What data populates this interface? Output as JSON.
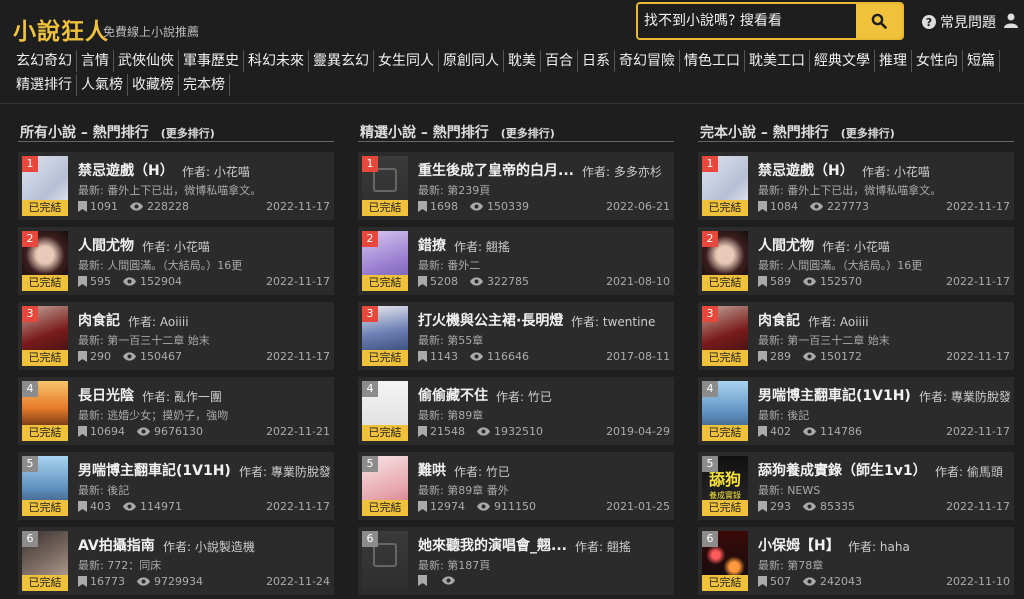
{
  "header": {
    "logo": "小說狂人",
    "tagline": "免費線上小說推薦",
    "search_placeholder": "找不到小說嗎? 搜看看",
    "faq": "常見問題"
  },
  "categories": [
    "玄幻奇幻",
    "言情",
    "武俠仙俠",
    "軍事歷史",
    "科幻未來",
    "靈異玄幻",
    "女生同人",
    "原創同人",
    "耽美",
    "百合",
    "日系",
    "奇幻冒險",
    "情色工口",
    "耽美工口",
    "經典文學",
    "推理",
    "女性向",
    "短篇",
    "精選排行",
    "人氣榜",
    "收藏榜",
    "完本榜"
  ],
  "labels": {
    "author_prefix": "作者:",
    "completed": "已完結"
  },
  "columns": [
    {
      "title": "所有小說 – 熱門排行",
      "more": "(更多排行)",
      "items": [
        {
          "rank": "1",
          "title": "禁忌遊戲（H）",
          "author": "小花喵",
          "latest": "最新: 番外上下已出，微博私喵拿文。",
          "bookmarks": "1091",
          "views": "228228",
          "date": "2022-11-17",
          "art": "pale"
        },
        {
          "rank": "2",
          "title": "人間尤物",
          "author": "小花喵",
          "latest": "最新: 人間圓滿。（大結局。）16更",
          "bookmarks": "595",
          "views": "152904",
          "date": "2022-11-17",
          "art": "girl"
        },
        {
          "rank": "3",
          "title": "肉食記",
          "author": "Aoiiii",
          "latest": "最新: 第一百三十二章 始末",
          "bookmarks": "290",
          "views": "150467",
          "date": "2022-11-17",
          "art": "red"
        },
        {
          "rank": "4",
          "title": "長日光陰",
          "author": "亂作一團",
          "latest": "最新: 逃婚少女；摸奶子，強吻",
          "bookmarks": "10694",
          "views": "9676130",
          "date": "2022-11-21",
          "art": "sunset"
        },
        {
          "rank": "5",
          "title": "男喘博主翻車記(1V1H)",
          "author": "專業防脫發",
          "latest": "最新: 後記",
          "bookmarks": "403",
          "views": "114971",
          "date": "2022-11-17",
          "art": "blue"
        },
        {
          "rank": "6",
          "title": "AV拍攝指南",
          "author": "小說製造機",
          "latest": "最新: 772：同床",
          "bookmarks": "16773",
          "views": "9729934",
          "date": "2022-11-24",
          "art": "face"
        }
      ]
    },
    {
      "title": "精選小說 – 熱門排行",
      "more": "(更多排行)",
      "items": [
        {
          "rank": "1",
          "title": "重生後成了皇帝的白月...",
          "author": "多多亦杉",
          "latest": "最新: 第239頁",
          "bookmarks": "1698",
          "views": "150339",
          "date": "2022-06-21",
          "art": "empty"
        },
        {
          "rank": "2",
          "title": "錯撩",
          "author": "翹搖",
          "latest": "最新: 番外二",
          "bookmarks": "5208",
          "views": "322785",
          "date": "2021-08-10",
          "art": "purple"
        },
        {
          "rank": "3",
          "title": "打火機與公主裙·長明燈",
          "author": "twentine",
          "latest": "最新: 第55章",
          "bookmarks": "1143",
          "views": "116646",
          "date": "2017-08-11",
          "art": "dress"
        },
        {
          "rank": "4",
          "title": "偷偷藏不住",
          "author": "竹已",
          "latest": "最新: 第89章",
          "bookmarks": "21548",
          "views": "1932510",
          "date": "2019-04-29",
          "art": "white"
        },
        {
          "rank": "5",
          "title": "難哄",
          "author": "竹已",
          "latest": "最新: 第89章 番外",
          "bookmarks": "12974",
          "views": "911150",
          "date": "2021-01-25",
          "art": "pink"
        },
        {
          "rank": "6",
          "title": "她來聽我的演唱會_翹...",
          "author": "翹搖",
          "latest": "最新: 第187頁",
          "bookmarks": "",
          "views": "",
          "date": "",
          "art": "empty"
        }
      ]
    },
    {
      "title": "完本小說 – 熱門排行",
      "more": "(更多排行)",
      "items": [
        {
          "rank": "1",
          "title": "禁忌遊戲（H）",
          "author": "小花喵",
          "latest": "最新: 番外上下已出，微博私喵拿文。",
          "bookmarks": "1084",
          "views": "227773",
          "date": "2022-11-17",
          "art": "pale"
        },
        {
          "rank": "2",
          "title": "人間尤物",
          "author": "小花喵",
          "latest": "最新: 人間圓滿。（大結局。）16更",
          "bookmarks": "589",
          "views": "152570",
          "date": "2022-11-17",
          "art": "girl"
        },
        {
          "rank": "3",
          "title": "肉食記",
          "author": "Aoiiii",
          "latest": "最新: 第一百三十二章 始末",
          "bookmarks": "289",
          "views": "150172",
          "date": "2022-11-17",
          "art": "red"
        },
        {
          "rank": "4",
          "title": "男喘博主翻車記(1V1H)",
          "author": "專業防脫發",
          "latest": "最新: 後記",
          "bookmarks": "402",
          "views": "114786",
          "date": "2022-11-17",
          "art": "blue"
        },
        {
          "rank": "5",
          "title": "舔狗養成實錄（師生1v1）",
          "author": "偷馬頭",
          "latest": "最新: NEWS",
          "bookmarks": "293",
          "views": "85335",
          "date": "2022-11-17",
          "art": "yellowtext"
        },
        {
          "rank": "6",
          "title": "小保姆【H】",
          "author": "haha",
          "latest": "最新: 第78章",
          "bookmarks": "507",
          "views": "242043",
          "date": "2022-11-10",
          "art": "bokeh"
        }
      ]
    }
  ]
}
